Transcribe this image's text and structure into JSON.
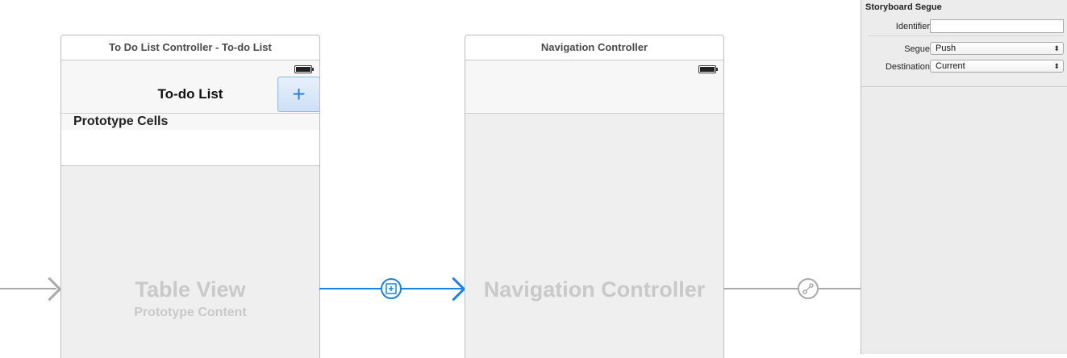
{
  "scenes": {
    "todo": {
      "title": "To Do List Controller - To-do List",
      "nav_title": "To-do List",
      "add_icon": "plus-icon",
      "section_header": "Prototype Cells",
      "placeholder_title": "Table View",
      "placeholder_subtitle": "Prototype Content"
    },
    "nav": {
      "title": "Navigation Controller",
      "placeholder_title": "Navigation Controller"
    }
  },
  "segues": {
    "modal_icon": "modal-segue-icon",
    "push_icon": "push-segue-icon",
    "selected_color": "#1a84e6",
    "default_color": "#aaaaaa"
  },
  "inspector": {
    "header": "Storyboard Segue",
    "identifier_label": "Identifier",
    "identifier_value": "",
    "segue_label": "Segue",
    "segue_value": "Push",
    "destination_label": "Destination",
    "destination_value": "Current"
  }
}
